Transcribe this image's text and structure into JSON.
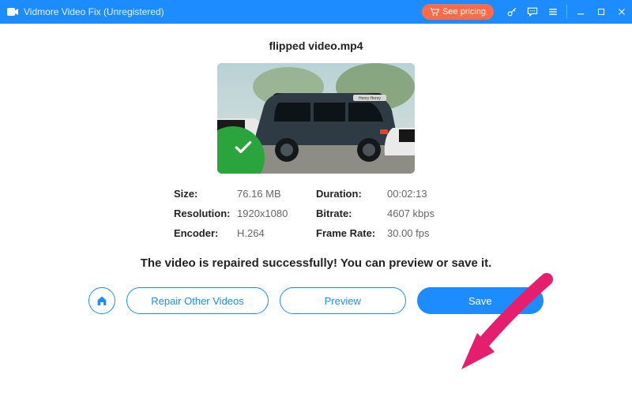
{
  "titlebar": {
    "app_title": "Vidmore Video Fix (Unregistered)",
    "pricing_label": "See pricing"
  },
  "file": {
    "name": "flipped video.mp4"
  },
  "info": {
    "size_label": "Size:",
    "size_value": "76.16 MB",
    "duration_label": "Duration:",
    "duration_value": "00:02:13",
    "resolution_label": "Resolution:",
    "resolution_value": "1920x1080",
    "bitrate_label": "Bitrate:",
    "bitrate_value": "4607 kbps",
    "encoder_label": "Encoder:",
    "encoder_value": "H.264",
    "framerate_label": "Frame Rate:",
    "framerate_value": "30.00 fps"
  },
  "message": "The video is repaired successfully! You can preview or save it.",
  "buttons": {
    "repair_other": "Repair Other Videos",
    "preview": "Preview",
    "save": "Save"
  }
}
